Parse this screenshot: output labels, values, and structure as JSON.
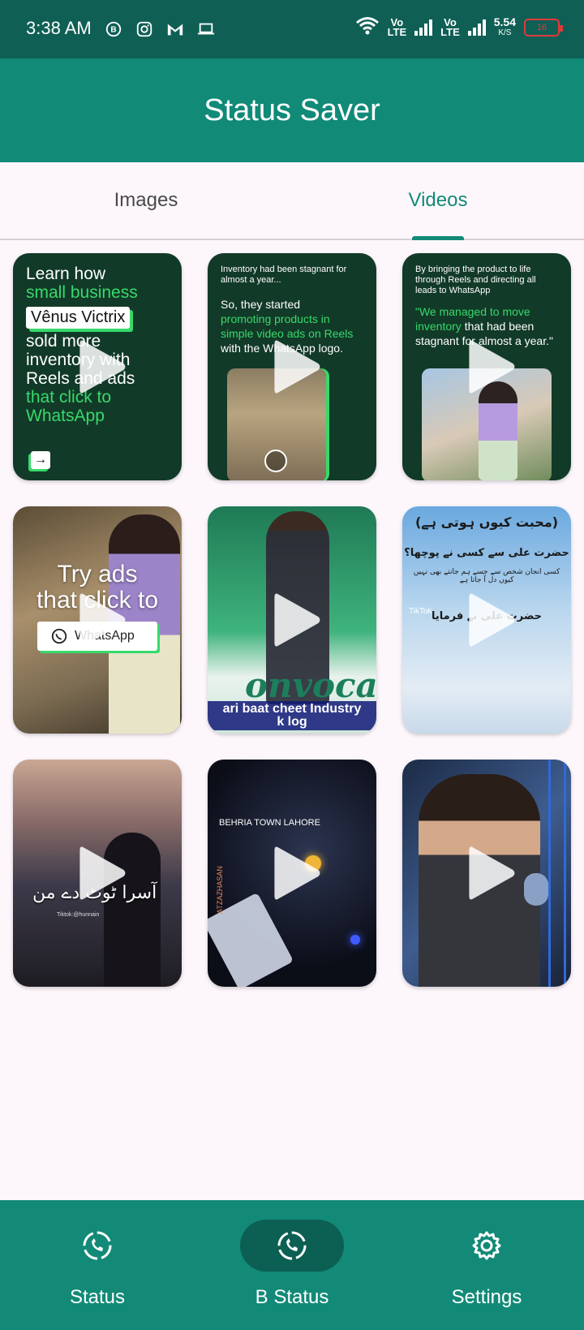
{
  "status_bar": {
    "time": "3:38 AM",
    "left_icons": [
      "whatsapp-business-icon",
      "instagram-icon",
      "gmail-icon",
      "laptop-icon"
    ],
    "network_1": [
      "Vo",
      "LTE"
    ],
    "network_2": [
      "Vo",
      "LTE"
    ],
    "speed_value": "5.54",
    "speed_unit": "K/S",
    "battery": "16"
  },
  "app_bar": {
    "title": "Status Saver"
  },
  "tabs": [
    {
      "label": "Images",
      "active": false
    },
    {
      "label": "Videos",
      "active": true
    }
  ],
  "videos": [
    {
      "name": "video-1",
      "lines": [
        "Learn how",
        "small business",
        "Vênus Victrix",
        "sold more",
        "inventory with",
        "Reels and ads",
        "that click to",
        "WhatsApp"
      ]
    },
    {
      "name": "video-2",
      "top": "Inventory had been stagnant for almost a year...",
      "line1": "So, they started",
      "line2": "promoting products in simple video ads on Reels",
      "line3": "with the WhatsApp logo."
    },
    {
      "name": "video-3",
      "top": "By bringing the product to life through Reels and directing all leads to WhatsApp",
      "quote_green": "\"We managed to move inventory",
      "quote_white": "that had been stagnant for almost a year.\""
    },
    {
      "name": "video-4",
      "line1": "Try ads",
      "line2": "that click to",
      "button": "WhatsApp"
    },
    {
      "name": "video-5",
      "big": "onvocati",
      "caption1": "ari baat cheet Industry",
      "caption2": "k log"
    },
    {
      "name": "video-6",
      "title": "(محبت کیوں ہوتی ہے)",
      "line1": "حضرت علی سے کسی نے پوچھا؟",
      "line2": "کسی انجان شخص سے جسے ہم جانتے بھی نہیں کیوں دل آ جاتا ہے",
      "line3": "حضرت علی نے فرمایا",
      "tiktok": "TikTok"
    },
    {
      "name": "video-7",
      "urdu": "آسرا ٹوٹ دے من",
      "small": "Tiktok:@hunnain"
    },
    {
      "name": "video-8",
      "location": "BEHRIA TOWN LAHORE",
      "side": "ATZAZHASAN"
    },
    {
      "name": "video-9"
    }
  ],
  "bottom_nav": [
    {
      "label": "Status",
      "icon": "whatsapp-status-icon",
      "active": false
    },
    {
      "label": "B Status",
      "icon": "whatsapp-business-status-icon",
      "active": true
    },
    {
      "label": "Settings",
      "icon": "gear-icon",
      "active": false
    }
  ],
  "colors": {
    "status_bar": "#0f5f55",
    "primary": "#118a78",
    "accent": "#128a77",
    "background": "#fdf7fc"
  }
}
